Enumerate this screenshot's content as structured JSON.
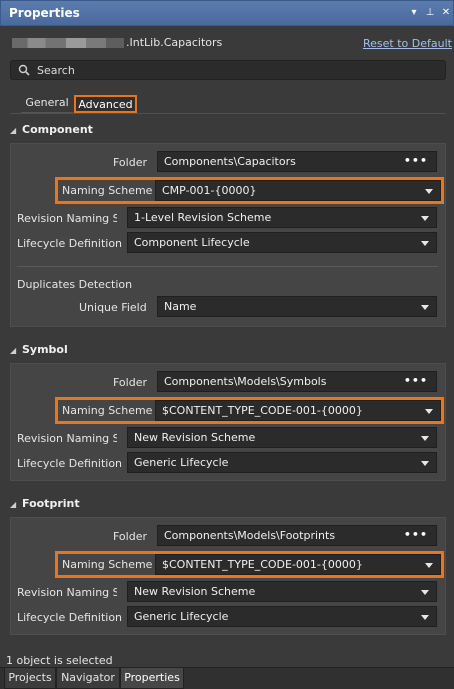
{
  "window": {
    "title": "Properties",
    "dropdown_glyph": "▾",
    "pin_glyph": "⊥",
    "close_glyph": "✕"
  },
  "header": {
    "library_suffix": ".IntLib.Capacitors",
    "reset_link": "Reset to Default"
  },
  "search": {
    "placeholder": "Search"
  },
  "tabs": [
    {
      "label": "General"
    },
    {
      "label": "Advanced"
    }
  ],
  "sections": {
    "component": {
      "title": "Component",
      "folder_label": "Folder",
      "folder_value": "Components\\Capacitors",
      "naming_label": "Naming Scheme",
      "naming_value": "CMP-001-{0000}",
      "revision_label": "Revision Naming Sc",
      "revision_value": "1-Level Revision Scheme",
      "lifecycle_label": "Lifecycle Definition",
      "lifecycle_value": "Component Lifecycle",
      "duplicates_title": "Duplicates Detection",
      "unique_label": "Unique Field",
      "unique_value": "Name"
    },
    "symbol": {
      "title": "Symbol",
      "folder_label": "Folder",
      "folder_value": "Components\\Models\\Symbols",
      "naming_label": "Naming Scheme",
      "naming_value": "$CONTENT_TYPE_CODE-001-{0000}",
      "revision_label": "Revision Naming Sc",
      "revision_value": "New Revision Scheme",
      "lifecycle_label": "Lifecycle Definition",
      "lifecycle_value": "Generic Lifecycle"
    },
    "footprint": {
      "title": "Footprint",
      "folder_label": "Folder",
      "folder_value": "Components\\Models\\Footprints",
      "naming_label": "Naming Scheme",
      "naming_value": "$CONTENT_TYPE_CODE-001-{0000}",
      "revision_label": "Revision Naming Sc",
      "revision_value": "New Revision Scheme",
      "lifecycle_label": "Lifecycle Definition",
      "lifecycle_value": "Generic Lifecycle"
    }
  },
  "folder_button_glyph": "•••",
  "status_text": "1 object is selected",
  "bottom_tabs": [
    {
      "label": "Projects"
    },
    {
      "label": "Navigator"
    },
    {
      "label": "Properties"
    }
  ],
  "colors": {
    "highlight": "#e8761e",
    "titlebar": "#4a6a9d",
    "link": "#9fc2ec"
  },
  "icons": {
    "search": "search-icon",
    "dropdown": "chevron-down-icon",
    "collapse": "triangle-collapse-icon"
  }
}
